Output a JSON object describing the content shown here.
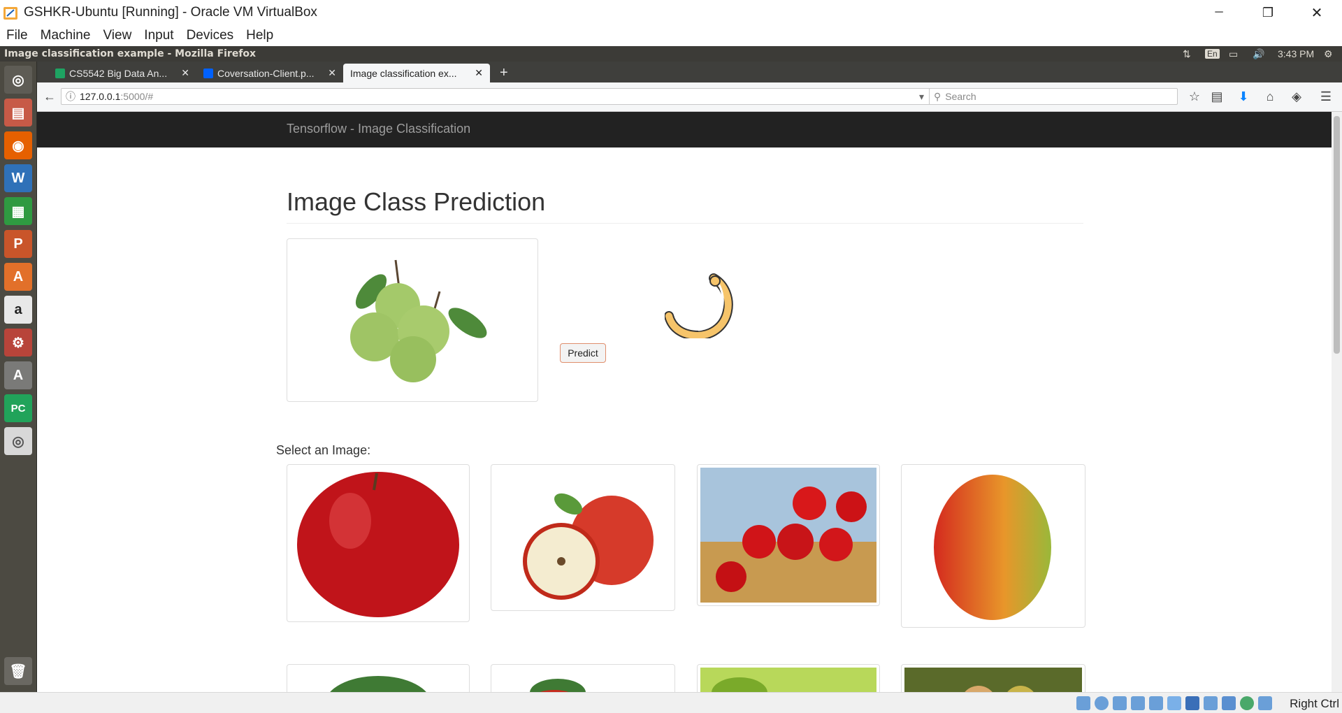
{
  "window": {
    "title": "GSHKR-Ubuntu [Running] - Oracle VM VirtualBox",
    "minimize": "─",
    "restore": "❐",
    "close": "✕"
  },
  "vbox_menu": [
    "File",
    "Machine",
    "View",
    "Input",
    "Devices",
    "Help"
  ],
  "panel": {
    "window_title": "Image classification example - Mozilla Firefox",
    "keyboard": "En",
    "time": "3:43 PM"
  },
  "launcher": [
    {
      "name": "ubuntu-dash-icon",
      "glyph": "◎",
      "color": "#5e5c55"
    },
    {
      "name": "files-icon",
      "glyph": "▤",
      "color": "#c75a47"
    },
    {
      "name": "firefox-icon",
      "glyph": "◉",
      "color": "#e66000"
    },
    {
      "name": "writer-icon",
      "glyph": "W",
      "color": "#2f71b8"
    },
    {
      "name": "calc-icon",
      "glyph": "▦",
      "color": "#2f9a41"
    },
    {
      "name": "impress-icon",
      "glyph": "P",
      "color": "#c9552a"
    },
    {
      "name": "software-center-icon",
      "glyph": "A",
      "color": "#e2702a"
    },
    {
      "name": "amazon-icon",
      "glyph": "a",
      "color": "#e8e8e8"
    },
    {
      "name": "system-settings-icon",
      "glyph": "⚙",
      "color": "#b8443a"
    },
    {
      "name": "software-updater-icon",
      "glyph": "A",
      "color": "#7a7a78"
    },
    {
      "name": "pycharm-icon",
      "glyph": "PC",
      "color": "#21a35a"
    },
    {
      "name": "dvd-icon",
      "glyph": "◎",
      "color": "#d8d8d8"
    }
  ],
  "trash_glyph": "🗑",
  "tabs": [
    {
      "label": "CS5542 Big Data An...",
      "fav": "#1ea362"
    },
    {
      "label": "Coversation-Client.p...",
      "fav": "#0061fe"
    },
    {
      "label": "Image classification ex...",
      "fav": "#f5f6f7"
    }
  ],
  "tab_close": "✕",
  "new_tab": "+",
  "nav": {
    "url_host": "127.0.0.1",
    "url_path": ":5000/#",
    "search_placeholder": "Search",
    "back": "←",
    "info": "ⓘ",
    "dropdown": "▾",
    "reload": "↻",
    "bookmark": "☆",
    "reader": "▤",
    "download": "⬇",
    "home": "⌂",
    "pocket": "◈",
    "menu": "☰"
  },
  "site": {
    "brand": "Tensorflow - Image Classification",
    "heading": "Image Class Prediction",
    "predict_label": "Predict",
    "select_label": "Select an Image:"
  },
  "status": {
    "host_key": "Right Ctrl"
  }
}
